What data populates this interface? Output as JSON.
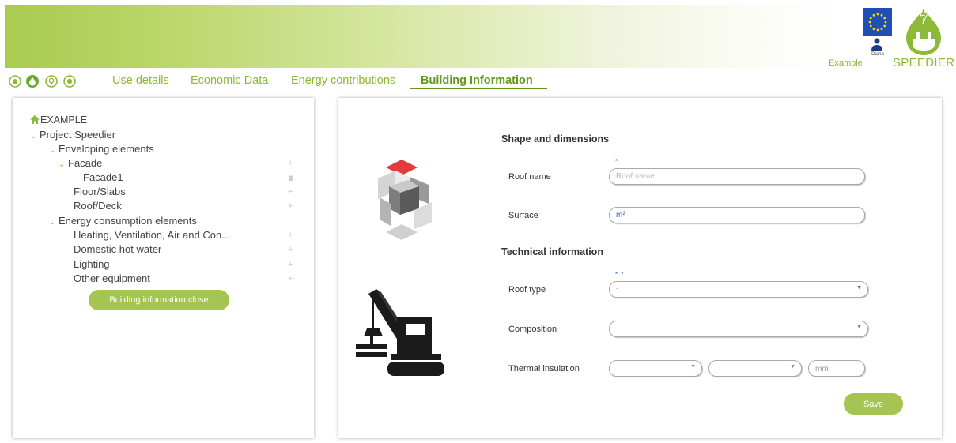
{
  "header": {
    "project_label": "Example",
    "user_name": "Diana",
    "brand_name": "SPEEDIER"
  },
  "nav": {
    "icons": [
      "home-icon",
      "building-icon",
      "lightbulb-icon",
      "energy-icon"
    ],
    "tabs": [
      {
        "label": "Use details",
        "active": false
      },
      {
        "label": "Economic Data",
        "active": false
      },
      {
        "label": "Energy contributions",
        "active": false
      },
      {
        "label": "Building Information",
        "active": true
      }
    ]
  },
  "tree": {
    "root": "EXAMPLE",
    "project": "Project Speedier",
    "enveloping": "Enveloping elements",
    "facade": "Facade",
    "facade1": "Facade1",
    "floor_slabs": "Floor/Slabs",
    "roof_deck": "Roof/Deck",
    "energy_consumption": "Energy consumption elements",
    "hvac": "Heating, Ventilation, Air and Con...",
    "dhw": "Domestic hot water",
    "lighting": "Lighting",
    "other_equipment": "Other equipment",
    "close_button": "Building information close",
    "add_symbol": "+"
  },
  "form": {
    "shape_title": "Shape and dimensions",
    "roof_name_label": "Roof name",
    "roof_name_placeholder": "Roof name",
    "roof_name_required": "*",
    "surface_label": "Surface",
    "surface_unit": "m²",
    "technical_title": "Technical information",
    "roof_type_label": "Roof type",
    "roof_type_required": "* *",
    "roof_type_value": "-",
    "composition_label": "Composition",
    "thermal_label": "Thermal insulation",
    "thermal_unit": "mm",
    "save_button": "Save"
  },
  "colors": {
    "accent_green": "#8cb936",
    "button_green": "#a5c552",
    "active_tab": "#5f9a1a",
    "required_blue": "#2a6cc8"
  }
}
